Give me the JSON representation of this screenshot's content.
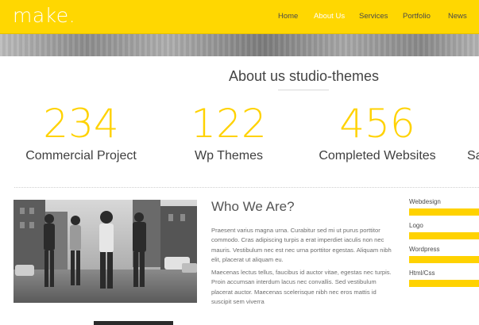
{
  "header": {
    "logo": "make.",
    "nav": [
      {
        "label": "Home",
        "active": false
      },
      {
        "label": "About Us",
        "active": true
      },
      {
        "label": "Services",
        "active": false
      },
      {
        "label": "Portfolio",
        "active": false
      },
      {
        "label": "News",
        "active": false
      }
    ]
  },
  "about": {
    "title": "About us studio-themes",
    "stats": [
      {
        "number": "234",
        "label": "Commercial Project"
      },
      {
        "number": "122",
        "label": "Wp Themes"
      },
      {
        "number": "456",
        "label": "Completed Websites"
      },
      {
        "number": "",
        "label": "Sa"
      }
    ]
  },
  "who": {
    "title": "Who We Are?",
    "paragraph1": "Praesent varius magna urna. Curabitur sed mi ut purus porttitor commodo. Cras adipiscing turpis a erat imperdiet iaculis non nec mauris. Vestibulum nec est nec urna porttitor egestas. Aliquam nibh elit, placerat ut aliquam eu.",
    "paragraph2": "Maecenas lectus tellus, faucibus id auctor vitae, egestas nec turpis. Proin accumsan interdum lacus nec convallis. Sed vestibulum placerat auctor. Maecenas scelerisque nibh nec eros mattis id suscipit sem viverra"
  },
  "skills": [
    {
      "label": "Webdesign",
      "percent": 100
    },
    {
      "label": "Logo",
      "percent": 100
    },
    {
      "label": "Wordpress",
      "percent": 100
    },
    {
      "label": "Html/Css",
      "percent": 100
    }
  ],
  "colors": {
    "accent": "#ffd701",
    "accent_text": "#ffd200",
    "nav_text": "#4a4a4a",
    "nav_active": "#ffffff",
    "body_text": "#3f3f3f"
  }
}
